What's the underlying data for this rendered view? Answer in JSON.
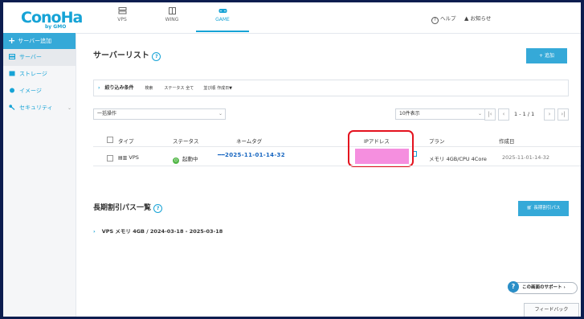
{
  "brand": {
    "logo": "ConoHa",
    "sub": "by GMO"
  },
  "tabs": [
    {
      "label": "VPS",
      "icon": "server-icon"
    },
    {
      "label": "WING",
      "icon": "building-icon"
    },
    {
      "label": "GAME",
      "icon": "gamepad-icon"
    }
  ],
  "header": {
    "help": "ヘルプ",
    "notice": "お知らせ"
  },
  "sidebar": {
    "add": "サーバー追加",
    "items": [
      {
        "label": "サーバー",
        "icon": "server-list-icon"
      },
      {
        "label": "ストレージ",
        "icon": "storage-icon"
      },
      {
        "label": "イメージ",
        "icon": "image-globe-icon"
      },
      {
        "label": "セキュリティ",
        "icon": "key-icon"
      }
    ]
  },
  "main": {
    "title": "サーバーリスト",
    "add_button": "追加",
    "filter": {
      "label": "絞り込み条件",
      "search": "検索",
      "status_label": "ステータス",
      "status_value": "全て",
      "sort_label": "並び順",
      "sort_value": "作成日▼"
    },
    "bulk": "一括操作",
    "per_page": "10件表示",
    "pagination": "1 - 1 / 1",
    "columns": [
      "タイプ",
      "ステータス",
      "ネームタグ",
      "IPアドレス",
      "プラン",
      "作成日"
    ],
    "row": {
      "type": "VPS",
      "status": "起動中",
      "nametag": "━━2025-11-01-14-32",
      "ip": "",
      "plan": "メモリ 4GB/CPU 4Core",
      "created": "2025-11-01-14-32"
    }
  },
  "longterm": {
    "title": "長期割引パス一覧",
    "button": "長期割引パス",
    "item": "VPS メモリ 4GB / 2024-03-18 - 2025-03-18"
  },
  "support": "この画面のサポート",
  "feedback": "フィードバック",
  "colors": {
    "accent": "#35a9d8",
    "highlight": "#e4121e",
    "mask": "#f58fdf",
    "status_ok": "#55b84a"
  }
}
